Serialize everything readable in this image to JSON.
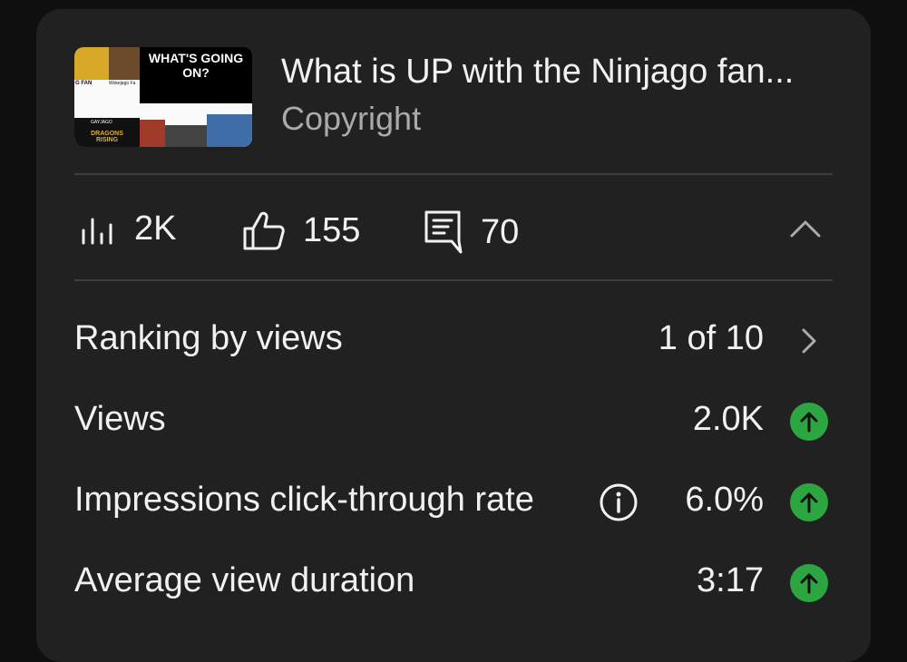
{
  "video": {
    "title": "What is UP with the Ninjago fan...",
    "subtitle": "Copyright",
    "thumbnail": {
      "headline": "WHAT'S GOING ON?",
      "fan_label_left": "G FAN",
      "fan_label_right": "Wokejago Fa",
      "gay_label": "GAYJAGO",
      "dragons_label": "DRAGONS RISING"
    }
  },
  "stats": {
    "views": "2K",
    "likes": "155",
    "comments": "70",
    "views_icon": "bar-chart-icon",
    "likes_icon": "thumb-up-icon",
    "comments_icon": "comment-icon",
    "collapse_icon": "chevron-up-icon"
  },
  "metrics": [
    {
      "label": "Ranking by views",
      "value": "1 of 10",
      "trail": "chevron-right-icon"
    },
    {
      "label": "Views",
      "value": "2.0K",
      "trail": "arrow-up-badge"
    },
    {
      "label": "Impressions click-through rate",
      "value": "6.0%",
      "trail": "arrow-up-badge",
      "info": true
    },
    {
      "label": "Average view duration",
      "value": "3:17",
      "trail": "arrow-up-badge"
    }
  ],
  "colors": {
    "background": "#0f0f0f",
    "card": "#212121",
    "text": "#f1f1f1",
    "muted": "#aaaaaa",
    "positive": "#2ba640"
  }
}
